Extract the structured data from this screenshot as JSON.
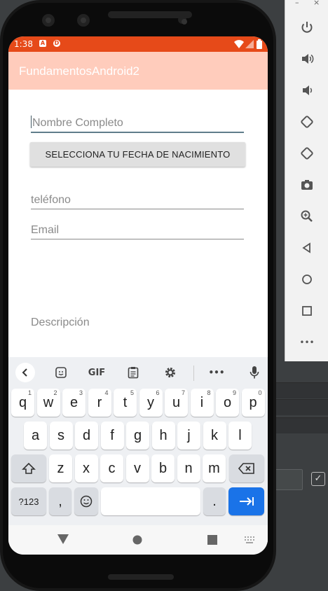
{
  "status_bar": {
    "time": "1:38",
    "icon_a": "A",
    "icon_b": "D"
  },
  "app_bar": {
    "title": "FundamentosAndroid2"
  },
  "form": {
    "name_placeholder": "Nombre Completo",
    "date_button": "SELECCIONA TU FECHA DE NACIMIENTO",
    "phone_placeholder": "teléfono",
    "email_placeholder": "Email",
    "description_placeholder": "Descripción"
  },
  "keyboard": {
    "toolbar": [
      "back-chevron",
      "sticker",
      "GIF",
      "clipboard",
      "settings",
      "more",
      "mic"
    ],
    "gif_label": "GIF",
    "more_label": "•••",
    "row1": [
      {
        "k": "q",
        "h": "1"
      },
      {
        "k": "w",
        "h": "2"
      },
      {
        "k": "e",
        "h": "3"
      },
      {
        "k": "r",
        "h": "4"
      },
      {
        "k": "t",
        "h": "5"
      },
      {
        "k": "y",
        "h": "6"
      },
      {
        "k": "u",
        "h": "7"
      },
      {
        "k": "i",
        "h": "8"
      },
      {
        "k": "o",
        "h": "9"
      },
      {
        "k": "p",
        "h": "0"
      }
    ],
    "row2": [
      "a",
      "s",
      "d",
      "f",
      "g",
      "h",
      "j",
      "k",
      "l"
    ],
    "row3": [
      "z",
      "x",
      "c",
      "v",
      "b",
      "n",
      "m"
    ],
    "symbols_label": "?123",
    "comma": ",",
    "period": "."
  },
  "emulator_panel": {
    "minimize": "–",
    "close": "×",
    "more": "•••",
    "buttons": [
      "power-icon",
      "volume-up-icon",
      "volume-down-icon",
      "rotate-left-icon",
      "rotate-right-icon",
      "camera-icon",
      "zoom-icon",
      "back-icon",
      "home-icon",
      "overview-icon",
      "more-icon"
    ]
  },
  "colors": {
    "status": "#e64a19",
    "appbar": "#ffccbc",
    "enter": "#1a73e8"
  }
}
